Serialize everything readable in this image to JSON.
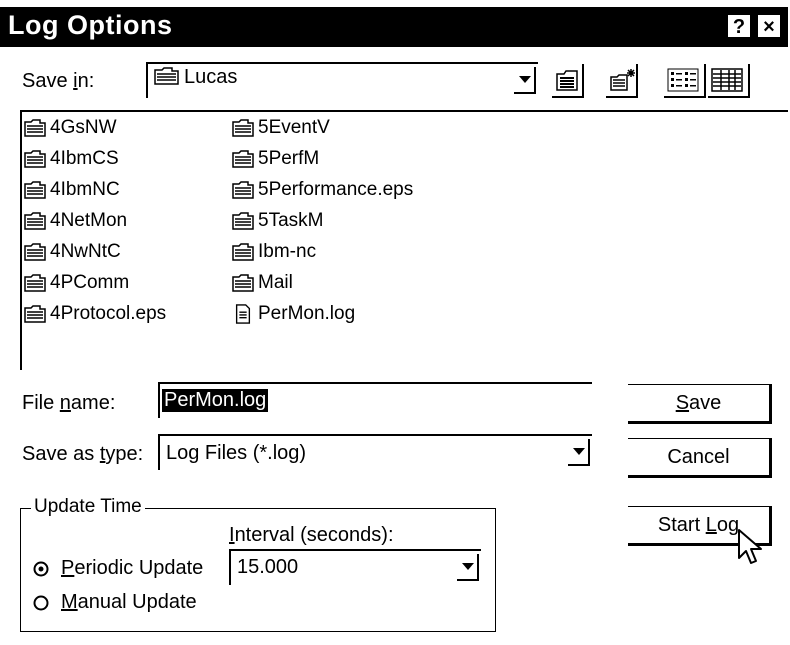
{
  "window": {
    "title": "Log Options",
    "help_icon": "?",
    "close_icon": "×"
  },
  "save_in": {
    "label_pre": "Save ",
    "label_accel": "i",
    "label_post": "n:",
    "value": "Lucas"
  },
  "files": {
    "column1": [
      "4GsNW",
      "4IbmCS",
      "4IbmNC",
      "4NetMon",
      "4NwNtC",
      "4PComm",
      "4Protocol.eps"
    ],
    "column2": [
      "5EventV",
      "5PerfM",
      "5Performance.eps",
      "5TaskM",
      "Ibm-nc",
      "Mail",
      "PerMon.log"
    ]
  },
  "file_name": {
    "label_pre": "File ",
    "label_accel": "n",
    "label_post": "ame:",
    "value": "PerMon.log"
  },
  "save_as_type": {
    "label_pre": "Save as ",
    "label_accel": "t",
    "label_post": "ype:",
    "value": "Log Files (*.log)"
  },
  "buttons": {
    "save": {
      "accel": "S",
      "rest": "ave"
    },
    "cancel": "Cancel",
    "start_log": {
      "pre": "Start ",
      "accel": "L",
      "rest": "og"
    }
  },
  "update_time": {
    "legend": "Update Time",
    "interval_label_accel": "I",
    "interval_label_rest": "nterval (seconds):",
    "interval_value": "15.000",
    "periodic": {
      "accel": "P",
      "rest": "eriodic Update",
      "checked": true
    },
    "manual": {
      "accel": "M",
      "rest": "anual Update",
      "checked": false
    }
  }
}
